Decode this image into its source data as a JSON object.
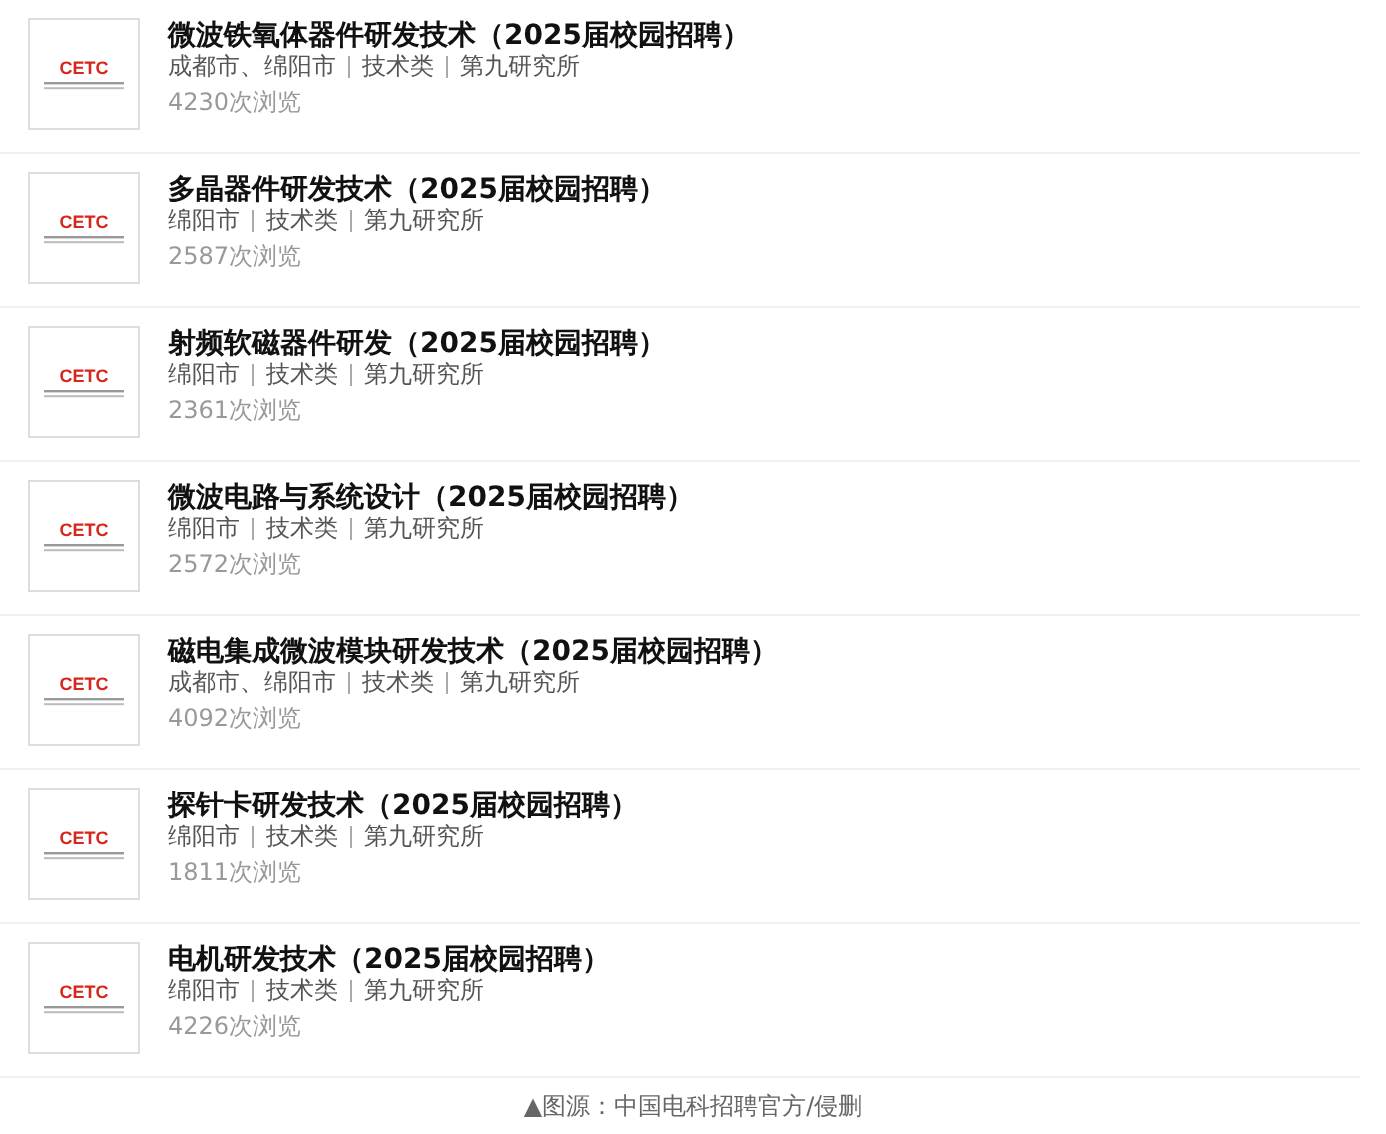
{
  "jobs": [
    {
      "logo": "CETC",
      "title": "微波铁氧体器件研发技术（2025届校园招聘）",
      "tags": [
        "成都市、绵阳市",
        "技术类",
        "第九研究所"
      ],
      "views": "4230次浏览"
    },
    {
      "logo": "CETC",
      "title": "多晶器件研发技术（2025届校园招聘）",
      "tags": [
        "绵阳市",
        "技术类",
        "第九研究所"
      ],
      "views": "2587次浏览"
    },
    {
      "logo": "CETC",
      "title": "射频软磁器件研发（2025届校园招聘）",
      "tags": [
        "绵阳市",
        "技术类",
        "第九研究所"
      ],
      "views": "2361次浏览"
    },
    {
      "logo": "CETC",
      "title": "微波电路与系统设计（2025届校园招聘）",
      "tags": [
        "绵阳市",
        "技术类",
        "第九研究所"
      ],
      "views": "2572次浏览"
    },
    {
      "logo": "CETC",
      "title": "磁电集成微波模块研发技术（2025届校园招聘）",
      "tags": [
        "成都市、绵阳市",
        "技术类",
        "第九研究所"
      ],
      "views": "4092次浏览"
    },
    {
      "logo": "CETC",
      "title": "探针卡研发技术（2025届校园招聘）",
      "tags": [
        "绵阳市",
        "技术类",
        "第九研究所"
      ],
      "views": "1811次浏览"
    },
    {
      "logo": "CETC",
      "title": "电机研发技术（2025届校园招聘）",
      "tags": [
        "绵阳市",
        "技术类",
        "第九研究所"
      ],
      "views": "4226次浏览"
    }
  ],
  "caption": "▲图源：中国电科招聘官方/侵删"
}
